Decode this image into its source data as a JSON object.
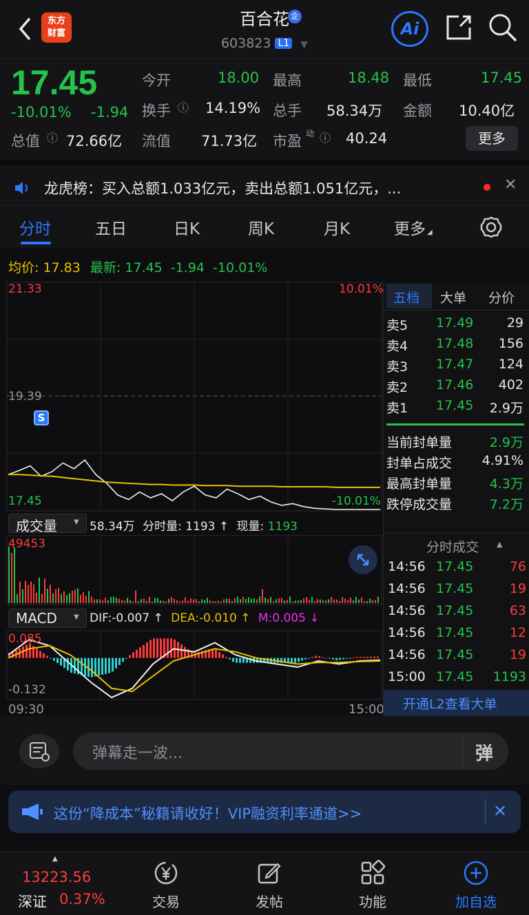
{
  "header": {
    "stock_name": "百合花",
    "badge": "企",
    "stock_code": "603823",
    "level_badge": "L1",
    "logo_line1": "东方",
    "logo_line2": "财富",
    "ai_label": "Ai"
  },
  "quote": {
    "price": "17.45",
    "change_pct": "-10.01%",
    "change": "-1.94",
    "fields": {
      "open_label": "今开",
      "open": "18.00",
      "high_label": "最高",
      "high": "18.48",
      "low_label": "最低",
      "low": "17.45",
      "turnover_label": "换手",
      "turnover": "14.19%",
      "volume_label": "总手",
      "volume": "58.34万",
      "amount_label": "金额",
      "amount": "10.40亿",
      "mktcap_label": "总值",
      "mktcap": "72.66亿",
      "float_label": "流值",
      "float": "71.73亿",
      "pe_label": "市盈",
      "pe_sup": "动",
      "pe": "40.24"
    },
    "more_button": "更多"
  },
  "dragon_tiger": {
    "text": "龙虎榜：买入总额1.033亿元，卖出总额1.051亿元，..."
  },
  "tabs": [
    "分时",
    "五日",
    "日K",
    "周K",
    "月K",
    "更多"
  ],
  "chart_header": {
    "avg_label": "均价:",
    "avg": "17.83",
    "latest_label": "最新:",
    "latest": "17.45",
    "change": "-1.94",
    "change_pct": "-10.01%"
  },
  "price_chart": {
    "y_top": "21.33",
    "y_mid": "19.39",
    "y_bottom": "17.45",
    "pct_top": "10.01%",
    "pct_bottom": "-10.01%",
    "marker": "S"
  },
  "volume_panel": {
    "label": "成交量",
    "total": "58.34万",
    "minute_label": "分时量:",
    "minute": "1193 ↑",
    "now_label": "现量:",
    "now": "1193",
    "y_max": "49453"
  },
  "macd_panel": {
    "label": "MACD",
    "dif": "DIF:-0.007 ↑",
    "dea": "DEA:-0.010 ↑",
    "m": "M:0.005 ↓",
    "y_top": "0.085",
    "y_bottom": "-0.132",
    "x_start": "09:30",
    "x_end": "15:00"
  },
  "order_book": {
    "tabs": [
      "五档",
      "大单",
      "分价"
    ],
    "asks": [
      {
        "label": "卖5",
        "price": "17.49",
        "vol": "29"
      },
      {
        "label": "卖4",
        "price": "17.48",
        "vol": "156"
      },
      {
        "label": "卖3",
        "price": "17.47",
        "vol": "124"
      },
      {
        "label": "卖2",
        "price": "17.46",
        "vol": "402"
      },
      {
        "label": "卖1",
        "price": "17.45",
        "vol": "2.9万"
      }
    ],
    "seal": [
      {
        "label": "当前封单量",
        "value": "2.9万"
      },
      {
        "label": "封单占成交",
        "value": "4.91%"
      },
      {
        "label": "最高封单量",
        "value": "4.3万"
      },
      {
        "label": "跌停成交量",
        "value": "7.2万"
      }
    ]
  },
  "ticks": {
    "title": "分时成交",
    "rows": [
      {
        "time": "14:56",
        "price": "17.45",
        "vol": "76",
        "dir": "red"
      },
      {
        "time": "14:56",
        "price": "17.45",
        "vol": "19",
        "dir": "red"
      },
      {
        "time": "14:56",
        "price": "17.45",
        "vol": "63",
        "dir": "red"
      },
      {
        "time": "14:56",
        "price": "17.45",
        "vol": "12",
        "dir": "red"
      },
      {
        "time": "14:56",
        "price": "17.45",
        "vol": "19",
        "dir": "red"
      },
      {
        "time": "15:00",
        "price": "17.45",
        "vol": "1193",
        "dir": "green"
      }
    ],
    "l2_link": "开通L2查看大单"
  },
  "danmu": {
    "placeholder": "弹幕走一波...",
    "send_label": "弹"
  },
  "banner": {
    "text": "这份“降成本”秘籍请收好！VIP融资利率通道>>"
  },
  "bottom_nav": {
    "index_value": "13223.56",
    "index_name": "深证",
    "index_pct": "0.37%",
    "items": [
      "交易",
      "发帖",
      "功能",
      "加自选"
    ]
  },
  "colors": {
    "up": "#ff3b3b",
    "down": "#27c24c",
    "accent": "#2a79ff",
    "avg_line": "#e6c300"
  },
  "chart_data": [
    {
      "type": "line",
      "title": "分时",
      "x": [
        "09:30",
        "15:00"
      ],
      "ylim": [
        17.45,
        21.33
      ],
      "series": [
        {
          "name": "price",
          "values": [
            18.05,
            18.12,
            18.2,
            18.02,
            18.1,
            18.25,
            18.15,
            18.3,
            18.05,
            17.9,
            17.7,
            17.62,
            17.75,
            17.65,
            17.72,
            17.6,
            17.75,
            17.85,
            17.7,
            17.65,
            17.8,
            17.72,
            17.62,
            17.68,
            17.58,
            17.52,
            17.55,
            17.5,
            17.47,
            17.46,
            17.45,
            17.45,
            17.45,
            17.45,
            17.45
          ]
        },
        {
          "name": "均价",
          "values": [
            18.05,
            18.05,
            18.04,
            18.03,
            18.02,
            18.0,
            17.98,
            17.96,
            17.94,
            17.92,
            17.91,
            17.9,
            17.89,
            17.88,
            17.88,
            17.87,
            17.87,
            17.87,
            17.86,
            17.86,
            17.86,
            17.85,
            17.85,
            17.85,
            17.85,
            17.84,
            17.84,
            17.84,
            17.84,
            17.84,
            17.83,
            17.83,
            17.83,
            17.83,
            17.83
          ]
        }
      ]
    },
    {
      "type": "bar",
      "title": "成交量",
      "ylim": [
        0,
        49453
      ]
    },
    {
      "type": "line",
      "title": "MACD",
      "ylim": [
        -0.132,
        0.085
      ],
      "series": [
        {
          "name": "DIF",
          "values": [
            0.01,
            0.06,
            0.04,
            -0.02,
            -0.08,
            -0.13,
            -0.1,
            -0.02,
            0.03,
            0.02,
            0.05,
            0.01,
            -0.01,
            -0.02,
            -0.03,
            -0.01,
            -0.02,
            -0.01,
            -0.007
          ]
        },
        {
          "name": "DEA",
          "values": [
            0.0,
            0.03,
            0.04,
            0.01,
            -0.04,
            -0.1,
            -0.11,
            -0.06,
            -0.01,
            0.01,
            0.03,
            0.02,
            0.0,
            -0.01,
            -0.02,
            -0.015,
            -0.015,
            -0.012,
            -0.01
          ]
        }
      ]
    }
  ]
}
